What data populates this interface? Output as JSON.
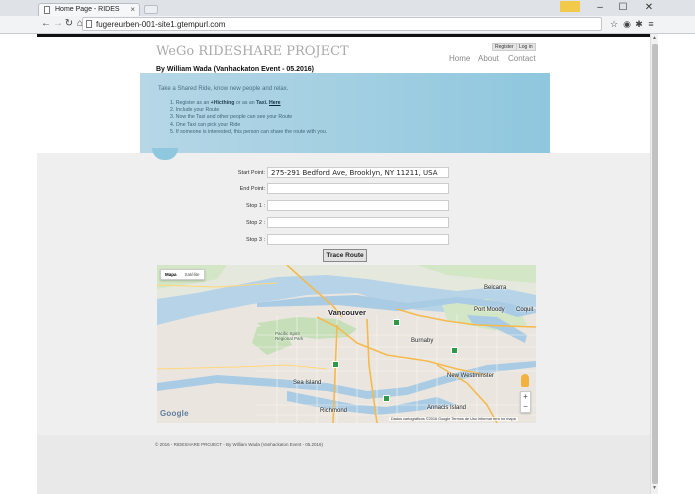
{
  "browser": {
    "tab_title": "Home Page - RIDES",
    "tab_close": "×",
    "url": "fugereurben-001-site1.gtempurl.com",
    "window_controls": [
      "–",
      "☐",
      "✕"
    ]
  },
  "site": {
    "title": "WeGo RIDESHARE PROJECT",
    "byline": "By William Wada (Vanhackaton Event - 05.2016)",
    "register_label": "Register",
    "login_label": "Log in",
    "nav": [
      "Home",
      "About",
      "Contact"
    ]
  },
  "hero": {
    "tagline": "Take a Shared Ride, know new people and relax.",
    "step1_prefix": "1. Register as an",
    "step1_hitching": "+Hicthing",
    "step1_mid": "or as an",
    "step1_taxi": "Taxi.",
    "step1_link": "Here",
    "steps": [
      "2. Include your Route",
      "3. Now the Taxi and other people can see your Route",
      "4. One Taxi can pick your Ride",
      "5. If someone is interested, this person can share the route with you."
    ]
  },
  "form": {
    "fields": [
      {
        "label": "Start Point:",
        "value": "275-291 Bedford Ave, Brooklyn, NY 11211, USA"
      },
      {
        "label": "End Point:",
        "value": ""
      },
      {
        "label": "Stop 1 :",
        "value": ""
      },
      {
        "label": "Stop 2 :",
        "value": ""
      },
      {
        "label": "Stop 3 :",
        "value": ""
      }
    ],
    "trace_label": "Trace Route"
  },
  "map": {
    "type_options": [
      "Mapa",
      "Satélite"
    ],
    "selected_type": "Mapa",
    "labels": {
      "vancouver": "Vancouver",
      "burnaby": "Burnaby",
      "richmond": "Richmond",
      "new_westminster": "New Westminster",
      "port_moody": "Port Moody",
      "coquitlam": "Coquit",
      "sea_island": "Sea Island",
      "annacis": "Annacis Island",
      "pacific_spirit": "Pacific Spirit Regional Park",
      "belcarra": "Belcarra"
    },
    "zoom_in": "+",
    "zoom_out": "−",
    "logo": "Google",
    "attribution": "Dados cartográficos ©2016 Google    Termos de Uso    Informar erro no mapa"
  },
  "footer": {
    "text": "© 2016 - RIDESHARE PROJECT - By William Wada (Vanhackaton Event - 05.2016)"
  }
}
